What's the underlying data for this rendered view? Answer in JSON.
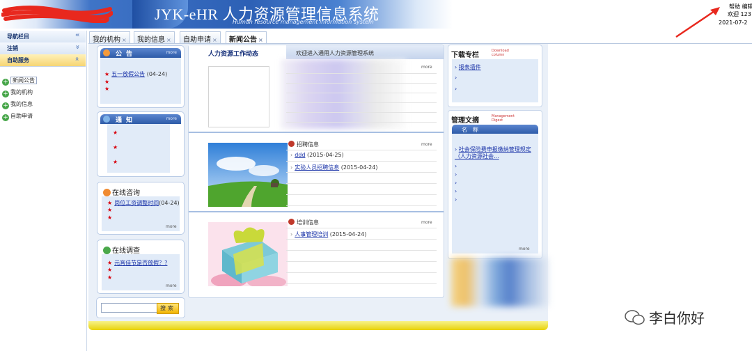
{
  "header": {
    "system_title": "JYK-eHR 人力资源管理信息系统",
    "system_subtitle": "Human resource management information system",
    "help": "帮助  编辑",
    "welcome": "欢迎 123",
    "date": "2021-07-2"
  },
  "leftnav": {
    "bars": [
      {
        "label": "导航栏目",
        "chevron": "«"
      },
      {
        "label": "注销",
        "chevron": "»"
      },
      {
        "label": "自助服务",
        "chevron": "»"
      }
    ],
    "items": [
      {
        "label": "新闻公告"
      },
      {
        "label": "我的机构"
      },
      {
        "label": "我的信息"
      },
      {
        "label": "自助申请"
      }
    ]
  },
  "tabs": [
    {
      "label": "我的机构"
    },
    {
      "label": "我的信息"
    },
    {
      "label": "自助申请"
    },
    {
      "label": "新闻公告"
    }
  ],
  "tab_close": "×",
  "more": "more",
  "gonggao": {
    "title": "公告",
    "items": [
      {
        "text": "五一放假公告",
        "date": "(04-24)"
      }
    ]
  },
  "tongzhi": {
    "title": "通知"
  },
  "consult": {
    "title": "在线咨询",
    "items": [
      {
        "text": "岗位工资调整时间",
        "date": "(04-24)"
      }
    ]
  },
  "survey": {
    "title": "在线调查",
    "items": [
      {
        "text": "元宵佳节是否放假？?"
      }
    ]
  },
  "search": {
    "button": "搜索"
  },
  "news": {
    "tab_label": "人力资源工作动态",
    "welcome": "欢迎进入通用人力资源管理系统"
  },
  "recruit": {
    "title": "招聘信息",
    "items": [
      {
        "text": "ddd",
        "date": "(2015-04-25)"
      },
      {
        "text": "实验人员招聘信息",
        "date": "(2015-04-24)"
      }
    ]
  },
  "training": {
    "title": "培训信息",
    "items": [
      {
        "text": "人事管理培训",
        "date": "(2015-04-24)"
      }
    ]
  },
  "download": {
    "title": "下载专栏",
    "sub": "Download column",
    "items": [
      {
        "text": "报表插件"
      }
    ]
  },
  "digest": {
    "title": "管理文摘",
    "sub": "Management Digest",
    "header": "名称",
    "items": [
      {
        "text": "社会保险费申报缴纳管理规定（人力资源社会..."
      }
    ]
  },
  "watermark": {
    "text": "李白你好"
  },
  "colors": {
    "banner_blue": "#2d60b5",
    "link_blue": "#1a33a8",
    "star_red": "#d8000c",
    "active_nav": "#f6d573",
    "footer_yellow": "#e8d20a"
  }
}
